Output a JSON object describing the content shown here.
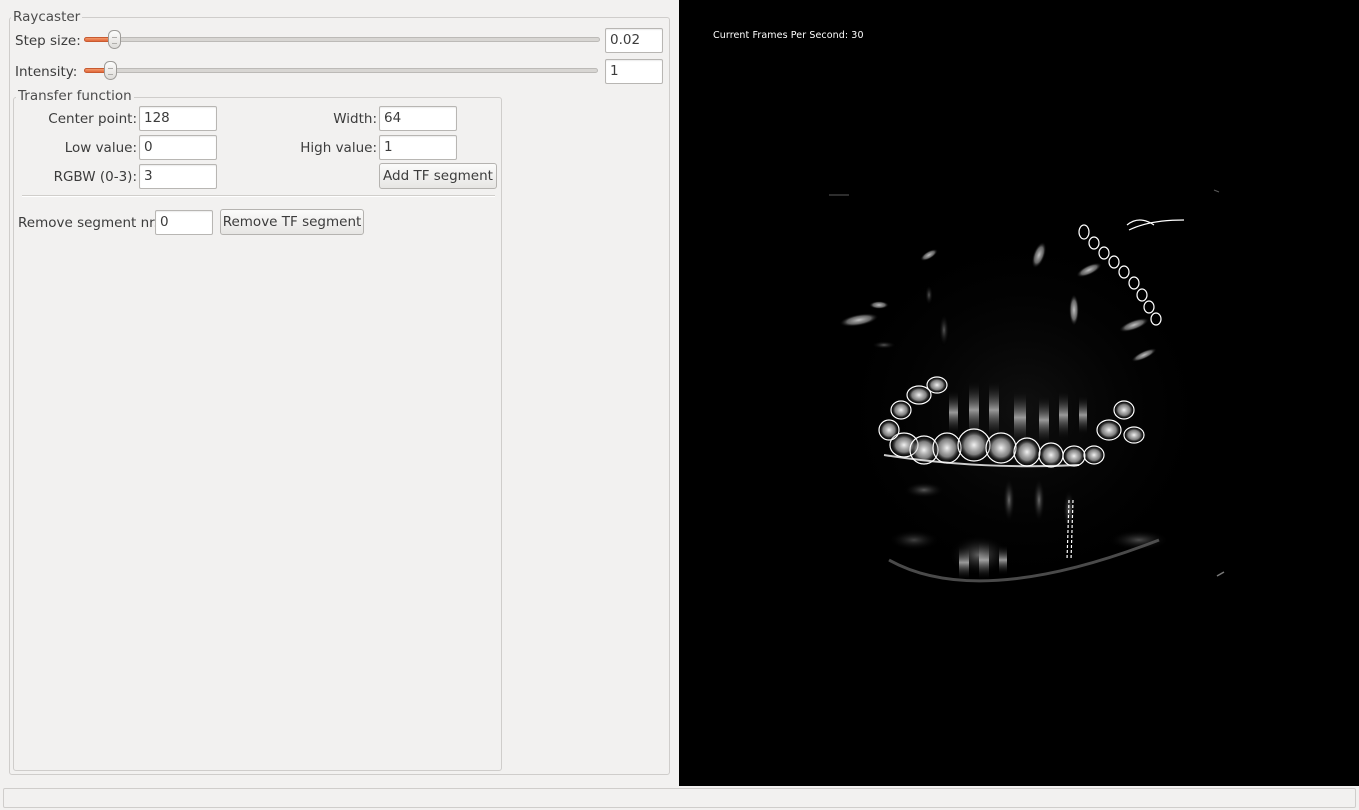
{
  "raycaster": {
    "title": "Raycaster",
    "step_size": {
      "label": "Step size:",
      "value": "0.02",
      "slider_fraction": 0.04
    },
    "intensity": {
      "label": "Intensity:",
      "value": "1",
      "slider_fraction": 0.03
    }
  },
  "transfer_function": {
    "title": "Transfer function",
    "center_point": {
      "label": "Center point:",
      "value": "128"
    },
    "width": {
      "label": "Width:",
      "value": "64"
    },
    "low_value": {
      "label": "Low value:",
      "value": "0"
    },
    "high_value": {
      "label": "High value:",
      "value": "1"
    },
    "rgbw": {
      "label": "RGBW (0-3):",
      "value": "3"
    },
    "add_button": "Add TF segment",
    "remove_label": "Remove segment nr.",
    "remove_value": "0",
    "remove_button": "Remove TF segment"
  },
  "render_view": {
    "fps_text": "Current Frames Per Second: 30"
  },
  "colors": {
    "slider_accent": "#e2683a",
    "render_background": "#000000",
    "panel_background": "#f2f1f0"
  }
}
